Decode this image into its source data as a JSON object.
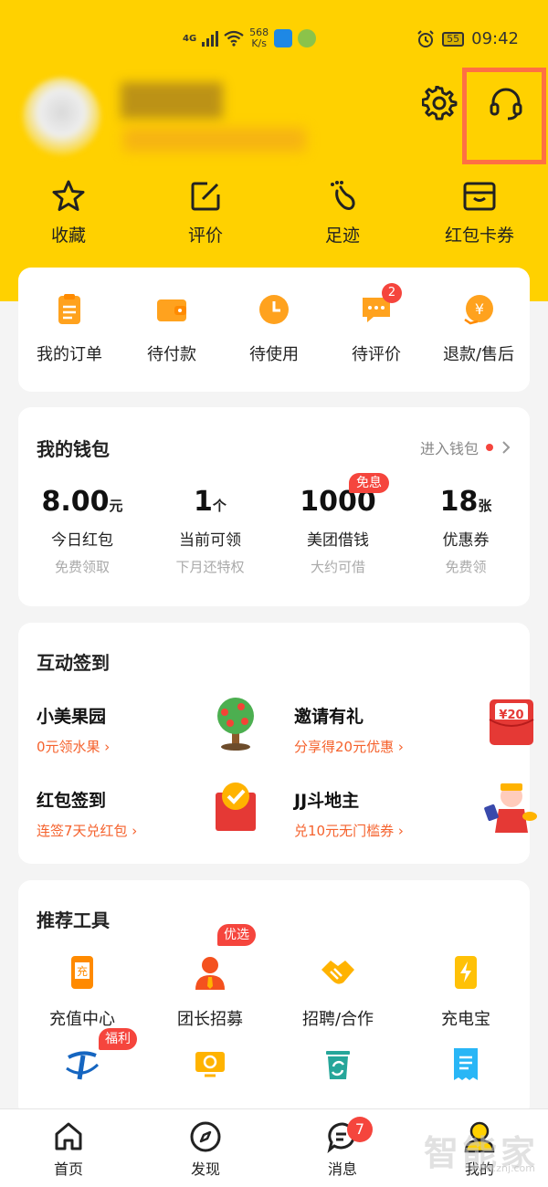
{
  "status_bar": {
    "signal": "4G",
    "net_speed_value": "568",
    "net_speed_unit": "K/s",
    "battery": "55",
    "time": "09:42"
  },
  "header": {
    "settings_icon": "gear-icon",
    "service_icon": "headset-icon"
  },
  "quick_nav": [
    {
      "label": "收藏",
      "icon": "star-icon"
    },
    {
      "label": "评价",
      "icon": "edit-icon"
    },
    {
      "label": "足迹",
      "icon": "footprint-icon"
    },
    {
      "label": "红包卡券",
      "icon": "wallet-card-icon"
    }
  ],
  "orders": {
    "items": [
      {
        "label": "我的订单",
        "icon": "order-list-icon"
      },
      {
        "label": "待付款",
        "icon": "wallet-icon"
      },
      {
        "label": "待使用",
        "icon": "clock-icon"
      },
      {
        "label": "待评价",
        "icon": "comment-icon",
        "badge": "2"
      },
      {
        "label": "退款/售后",
        "icon": "refund-icon"
      }
    ]
  },
  "wallet": {
    "title": "我的钱包",
    "link": "进入钱包",
    "items": [
      {
        "value": "8.00",
        "unit": "元",
        "label": "今日红包",
        "sub": "免费领取"
      },
      {
        "value": "1",
        "unit": "个",
        "label": "当前可领",
        "sub": "下月还特权"
      },
      {
        "value": "1000",
        "unit": "",
        "label": "美团借钱",
        "sub": "大约可借",
        "badge": "免息"
      },
      {
        "value": "18",
        "unit": "张",
        "label": "优惠券",
        "sub": "免费领"
      }
    ]
  },
  "interact": {
    "title": "互动签到",
    "items": [
      {
        "title": "小美果园",
        "sub": "0元领水果 ›",
        "icon": "tree-icon"
      },
      {
        "title": "邀请有礼",
        "sub": "分享得20元优惠 ›",
        "icon": "red-envelope-icon",
        "pic_text": "¥20"
      },
      {
        "title": "红包签到",
        "sub": "连签7天兑红包 ›",
        "icon": "checkin-icon"
      },
      {
        "title": "JJ斗地主",
        "sub": "兑10元无门槛券 ›",
        "icon": "god-of-wealth-icon"
      }
    ]
  },
  "tools": {
    "title": "推荐工具",
    "items": [
      {
        "label": "充值中心",
        "icon": "recharge-phone-icon",
        "glyph": "充"
      },
      {
        "label": "团长招募",
        "icon": "leader-icon",
        "badge": "优选"
      },
      {
        "label": "招聘/合作",
        "icon": "handshake-icon"
      },
      {
        "label": "充电宝",
        "icon": "powerbank-icon"
      },
      {
        "label": "",
        "icon": "telecom-icon",
        "badge": "福利"
      },
      {
        "label": "",
        "icon": "lamp-icon"
      },
      {
        "label": "",
        "icon": "recycle-bin-icon"
      },
      {
        "label": "",
        "icon": "receipt-icon"
      }
    ]
  },
  "bottom_nav": [
    {
      "label": "首页",
      "icon": "home-icon"
    },
    {
      "label": "发现",
      "icon": "compass-icon"
    },
    {
      "label": "消息",
      "icon": "message-icon",
      "badge": "7"
    },
    {
      "label": "我的",
      "icon": "profile-icon"
    }
  ],
  "watermark": {
    "text": "智能家",
    "url": "www.znj.com"
  },
  "colors": {
    "brand_yellow": "#FFD100",
    "accent_orange": "#F5622D",
    "badge_red": "#F5453D",
    "highlight": "#FF7043"
  }
}
